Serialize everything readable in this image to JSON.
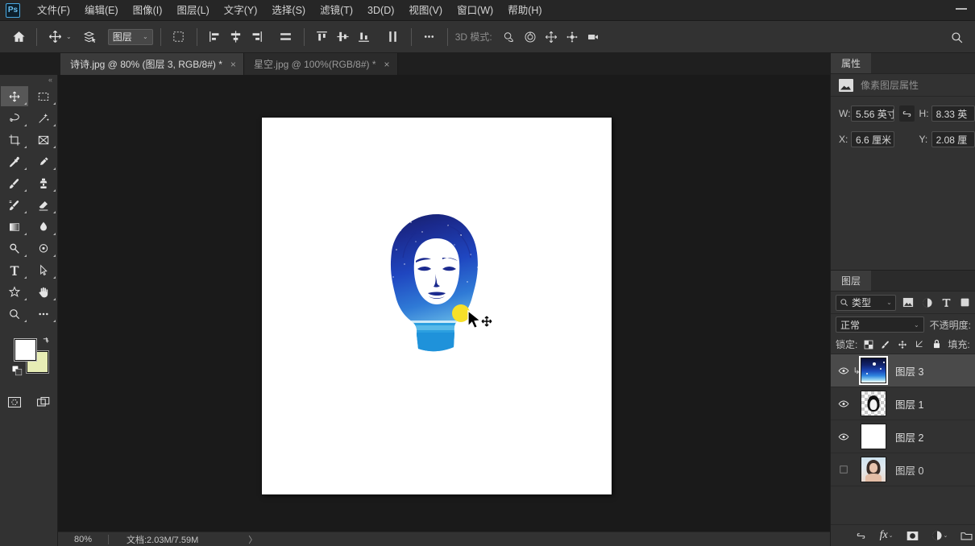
{
  "app": {
    "logo": "Ps",
    "minimize": "—"
  },
  "menubar": {
    "items": [
      {
        "label": "文件(F)"
      },
      {
        "label": "编辑(E)"
      },
      {
        "label": "图像(I)"
      },
      {
        "label": "图层(L)"
      },
      {
        "label": "文字(Y)"
      },
      {
        "label": "选择(S)"
      },
      {
        "label": "滤镜(T)"
      },
      {
        "label": "3D(D)"
      },
      {
        "label": "视图(V)"
      },
      {
        "label": "窗口(W)"
      },
      {
        "label": "帮助(H)"
      }
    ]
  },
  "options_bar": {
    "home_icon": "home-icon",
    "move_tool_icon": "move-tool-icon",
    "auto_select_icon": "auto-select-layer-icon",
    "layer_select_value": "图层",
    "transform_controls_icon": "show-transform-controls-icon",
    "align_left_icon": "align-left-icon",
    "align_center_h_icon": "align-center-horizontal-icon",
    "align_right_icon": "align-right-icon",
    "distribute_h_icon": "distribute-horizontal-icon",
    "align_top_icon": "align-top-icon",
    "align_middle_v_icon": "align-middle-vertical-icon",
    "align_bottom_icon": "align-bottom-icon",
    "distribute_v_icon": "distribute-vertical-icon",
    "more_options_icon": "more-options-icon",
    "mode_3d_label": "3D 模式:",
    "mode_3d_icons": [
      "orbit-3d-icon",
      "roll-3d-icon",
      "pan-3d-icon",
      "slide-3d-icon",
      "camera-3d-icon"
    ],
    "search_icon": "search-icon"
  },
  "tabs": [
    {
      "title": "诗诗.jpg @ 80% (图层 3, RGB/8#) *",
      "close": "×",
      "active": true
    },
    {
      "title": "星空.jpg @ 100%(RGB/8#) *",
      "close": "×",
      "active": false
    }
  ],
  "toolbar": {
    "tools": [
      {
        "name": "move-tool",
        "active": true
      },
      {
        "name": "rectangular-marquee-tool",
        "active": false
      },
      {
        "name": "lasso-tool",
        "active": false
      },
      {
        "name": "magic-wand-tool",
        "active": false
      },
      {
        "name": "crop-tool",
        "active": false
      },
      {
        "name": "frame-tool",
        "active": false
      },
      {
        "name": "eyedropper-tool",
        "active": false
      },
      {
        "name": "healing-brush-tool",
        "active": false
      },
      {
        "name": "brush-tool",
        "active": false
      },
      {
        "name": "clone-stamp-tool",
        "active": false
      },
      {
        "name": "history-brush-tool",
        "active": false
      },
      {
        "name": "eraser-tool",
        "active": false
      },
      {
        "name": "gradient-tool",
        "active": false
      },
      {
        "name": "blur-tool",
        "active": false
      },
      {
        "name": "dodge-tool",
        "active": false
      },
      {
        "name": "pen-tool",
        "active": false
      },
      {
        "name": "horizontal-type-tool",
        "active": false
      },
      {
        "name": "path-selection-tool",
        "active": false
      },
      {
        "name": "custom-shape-tool",
        "active": false
      },
      {
        "name": "hand-tool",
        "active": false
      },
      {
        "name": "zoom-tool",
        "active": false
      },
      {
        "name": "edit-toolbar-tool",
        "active": false
      }
    ],
    "foreground_color": "#ffffff",
    "background_color": "#e7edb5",
    "swap_colors_icon": "swap-colors-icon",
    "default_colors_icon": "default-colors-icon",
    "quick_mask_icon": "quick-mask-icon",
    "screen_mode_icon": "screen-mode-icon"
  },
  "canvas": {
    "background_color": "#1a1a1a",
    "document_color": "#ffffff",
    "artwork_description": "portrait-silhouette-starry-sky",
    "cursor_icon": "move-cursor"
  },
  "statusbar": {
    "zoom": "80%",
    "doc_info": "文档:2.03M/7.59M",
    "arrow": "〉"
  },
  "properties_panel": {
    "tab_label": "属性",
    "header_icon": "pixel-layer-icon",
    "header_label": "像素图层属性",
    "fields": [
      {
        "label": "W:",
        "value": "5.56 英寸"
      },
      {
        "label": "H:",
        "value": "8.33 英"
      },
      {
        "label": "X:",
        "value": "6.6 厘米"
      },
      {
        "label": "Y:",
        "value": "2.08 厘"
      }
    ],
    "link_icon": "link-dimensions-icon"
  },
  "layers_panel": {
    "tab_label": "图层",
    "filter": {
      "search_icon": "search-icon",
      "kind_value": "类型",
      "chevron": "⌄",
      "icons": [
        "filter-pixel-layers-icon",
        "filter-adjustment-layers-icon",
        "filter-type-layers-icon",
        "filter-shape-layers-icon"
      ]
    },
    "blend_mode": "正常",
    "blend_chevron": "⌄",
    "opacity_label": "不透明度:",
    "lock_label": "锁定:",
    "lock_icons": [
      "lock-transparent-pixels-icon",
      "lock-image-pixels-icon",
      "lock-position-icon",
      "lock-artboard-nesting-icon",
      "lock-all-icon"
    ],
    "fill_label": "填充:",
    "layers": [
      {
        "name": "图层 3",
        "visible": true,
        "selected": true,
        "clipped": true,
        "thumb": "blue-sky"
      },
      {
        "name": "图层 1",
        "visible": true,
        "selected": false,
        "clipped": false,
        "thumb": "silhouette"
      },
      {
        "name": "图层 2",
        "visible": true,
        "selected": false,
        "clipped": false,
        "thumb": "white"
      },
      {
        "name": "图层 0",
        "visible": false,
        "selected": false,
        "clipped": false,
        "thumb": "photo"
      }
    ],
    "bottom_icons": [
      "link-layers-icon",
      "layer-style-fx-icon",
      "add-layer-mask-icon",
      "new-adjustment-layer-icon",
      "new-group-icon"
    ],
    "fx_label": "fx"
  }
}
